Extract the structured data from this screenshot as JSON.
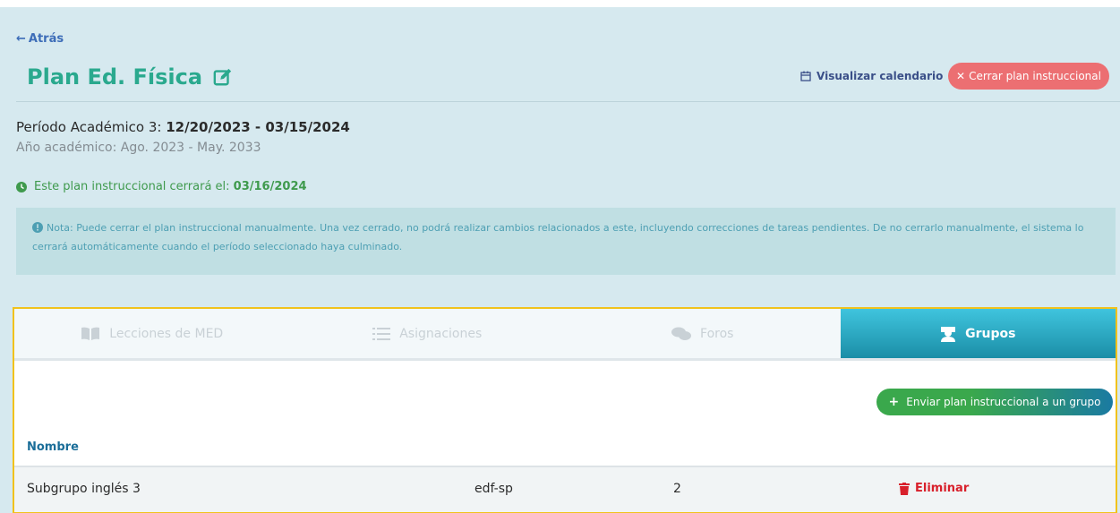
{
  "header": {
    "back_label": "Atrás",
    "title": "Plan Ed. Física",
    "calendar_link": "Visualizar calendario",
    "close_plan_label": "Cerrar plan instruccional"
  },
  "info": {
    "period_prefix": "Período Académico 3: ",
    "period_dates": "12/20/2023 - 03/15/2024",
    "academic_year": "Año académico: Ago. 2023 - May. 2033",
    "close_prefix": "Este plan instruccional cerrará el: ",
    "close_date": "03/16/2024",
    "note": "Nota: Puede cerrar el plan instruccional manualmente. Una vez cerrado, no podrá realizar cambios relacionados a este, incluyendo correcciones de tareas pendientes. De no cerrarlo manualmente, el sistema lo cerrará automáticamente cuando el período seleccionado haya culminado."
  },
  "tabs": [
    {
      "label": "Lecciones de MED",
      "icon": "book-icon"
    },
    {
      "label": "Asignaciones",
      "icon": "list-icon"
    },
    {
      "label": "Foros",
      "icon": "chat-icon"
    },
    {
      "label": "Grupos",
      "icon": "group-icon"
    }
  ],
  "active_tab": "Grupos",
  "groups": {
    "send_button_label": "Enviar plan instruccional a un grupo",
    "column_header": "Nombre",
    "rows": [
      {
        "name": "Subgrupo inglés 3",
        "code": "edf-sp",
        "count": "2",
        "action": "Eliminar"
      }
    ]
  },
  "colors": {
    "title": "#2aa98e",
    "close_button": "#ec6f72",
    "active_tab": "#1b8ea7",
    "highlight_border": "#f1c21c",
    "delete": "#d8202b"
  }
}
